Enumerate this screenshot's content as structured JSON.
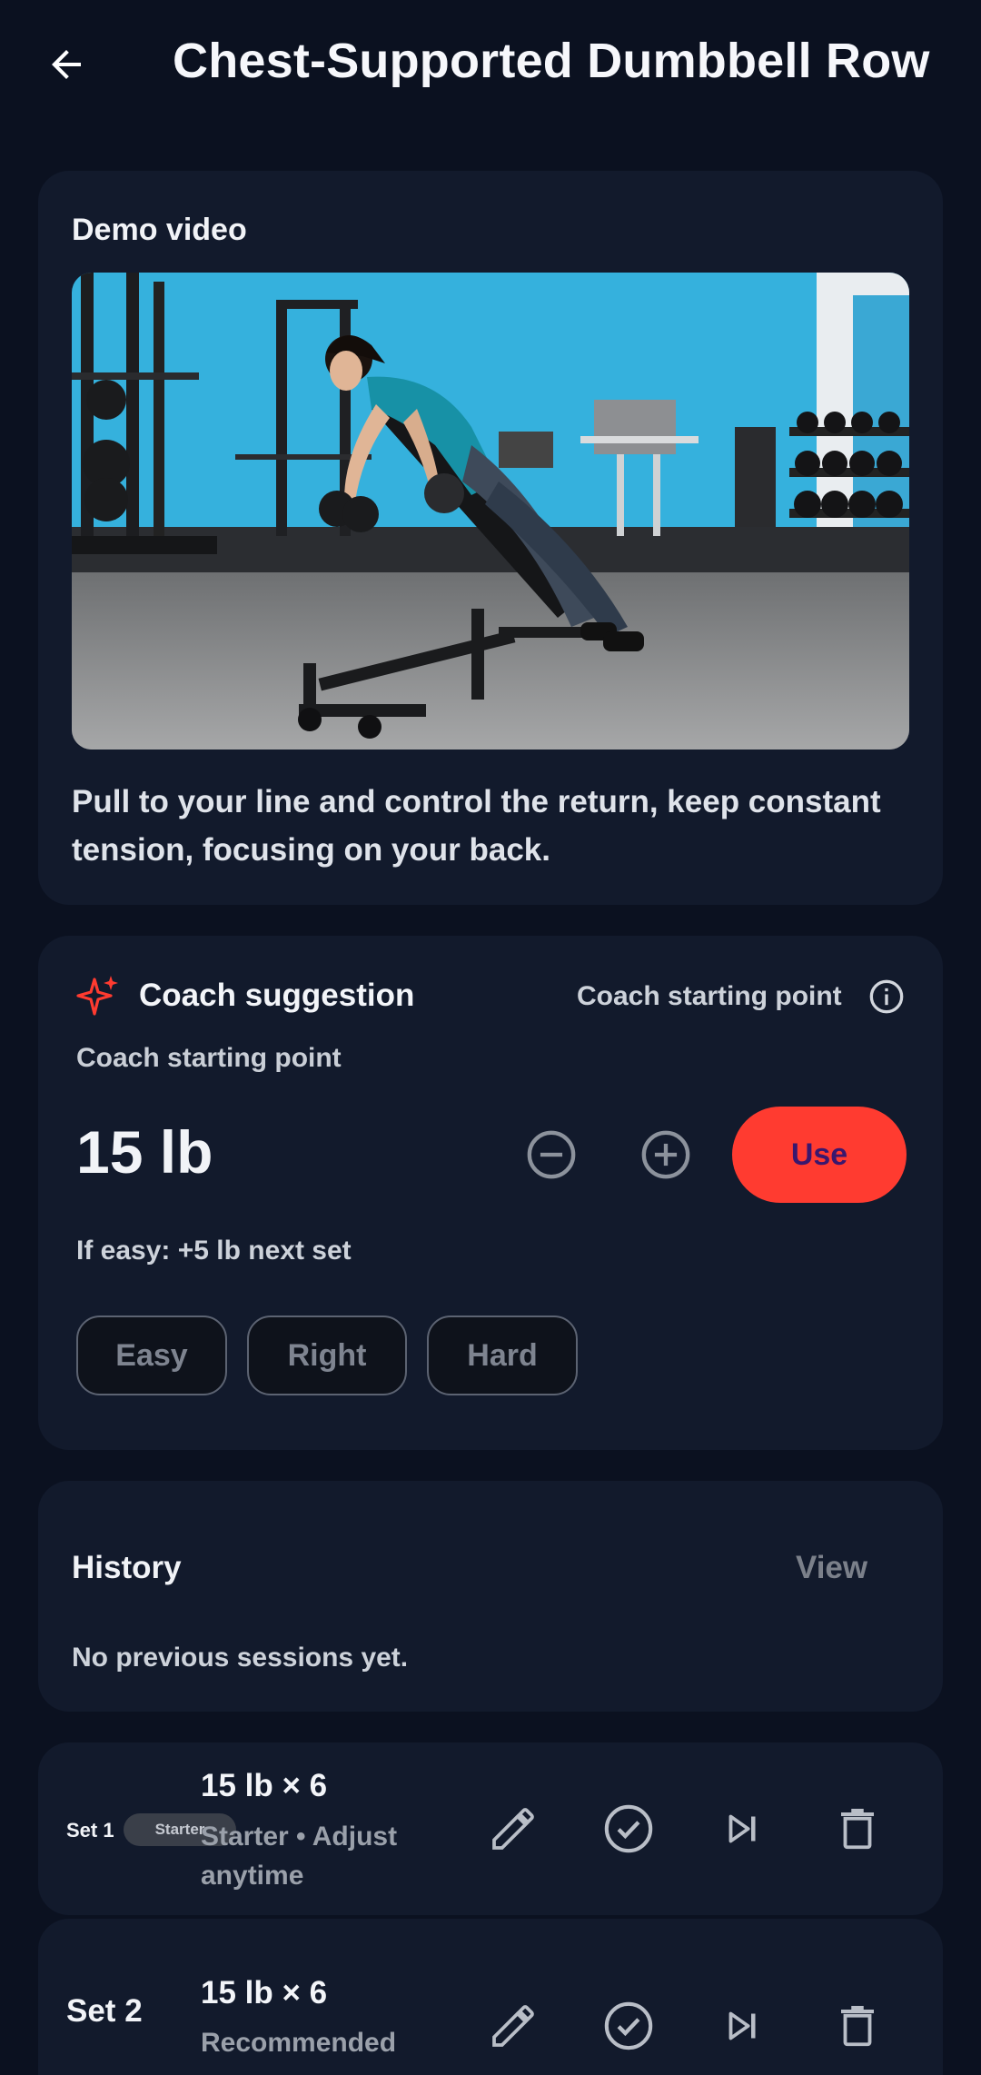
{
  "header": {
    "title": "Chest-Supported Dumbbell Row",
    "back_icon": "arrow-left-icon"
  },
  "demo": {
    "heading": "Demo video",
    "description": "Pull to your line and control the return, keep constant tension, focusing on your back."
  },
  "coach": {
    "title": "Coach suggestion",
    "starting_point_right": "Coach starting point",
    "starting_point_label": "Coach starting point",
    "weight": "15 lb",
    "use_label": "Use",
    "if_easy": "If easy: +5 lb next set",
    "feedback": [
      "Easy",
      "Right",
      "Hard"
    ],
    "accent_color": "#ff3b30"
  },
  "history": {
    "title": "History",
    "view_label": "View",
    "empty_text": "No previous sessions yet."
  },
  "sets": [
    {
      "label": "Set 1",
      "badge": "Starter",
      "main": "15 lb × 6",
      "sub": "Starter • Adjust anytime"
    },
    {
      "label": "Set 2",
      "main": "15 lb × 6",
      "sub": "Recommended"
    }
  ]
}
